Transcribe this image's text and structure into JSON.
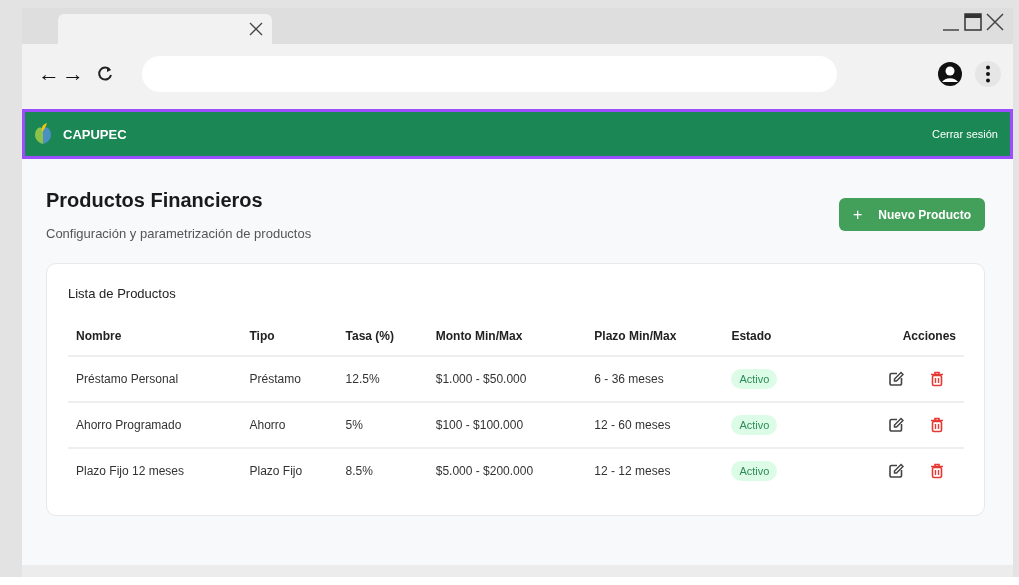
{
  "browser": {
    "nav": [
      "←",
      "→"
    ]
  },
  "header": {
    "brand": "CAPUPEC",
    "logout": "Cerrar sesión"
  },
  "page": {
    "title": "Productos Financieros",
    "subtitle": "Configuración y parametrización de productos",
    "new_button": {
      "icon": "+",
      "label": "Nuevo Producto"
    }
  },
  "table": {
    "title": "Lista de Productos",
    "columns": [
      "Nombre",
      "Tipo",
      "Tasa (%)",
      "Monto Min/Max",
      "Plazo Min/Max",
      "Estado",
      "Acciones"
    ],
    "rows": [
      {
        "cells": [
          "Préstamo Personal",
          "Préstamo",
          "12.5%",
          "$1.000 - $50.000",
          "6 - 36 meses"
        ],
        "status": {
          "label": "Activo",
          "kind": "success"
        }
      },
      {
        "cells": [
          "Ahorro Programado",
          "Ahorro",
          "5%",
          "$100 - $100.000",
          "12 - 60 meses"
        ],
        "status": {
          "label": "Activo",
          "kind": "success"
        }
      },
      {
        "cells": [
          "Plazo Fijo 12 meses",
          "Plazo Fijo",
          "8.5%",
          "$5.000 - $200.000",
          "12 - 12 meses"
        ],
        "status": {
          "label": "Activo",
          "kind": "success"
        }
      }
    ]
  }
}
